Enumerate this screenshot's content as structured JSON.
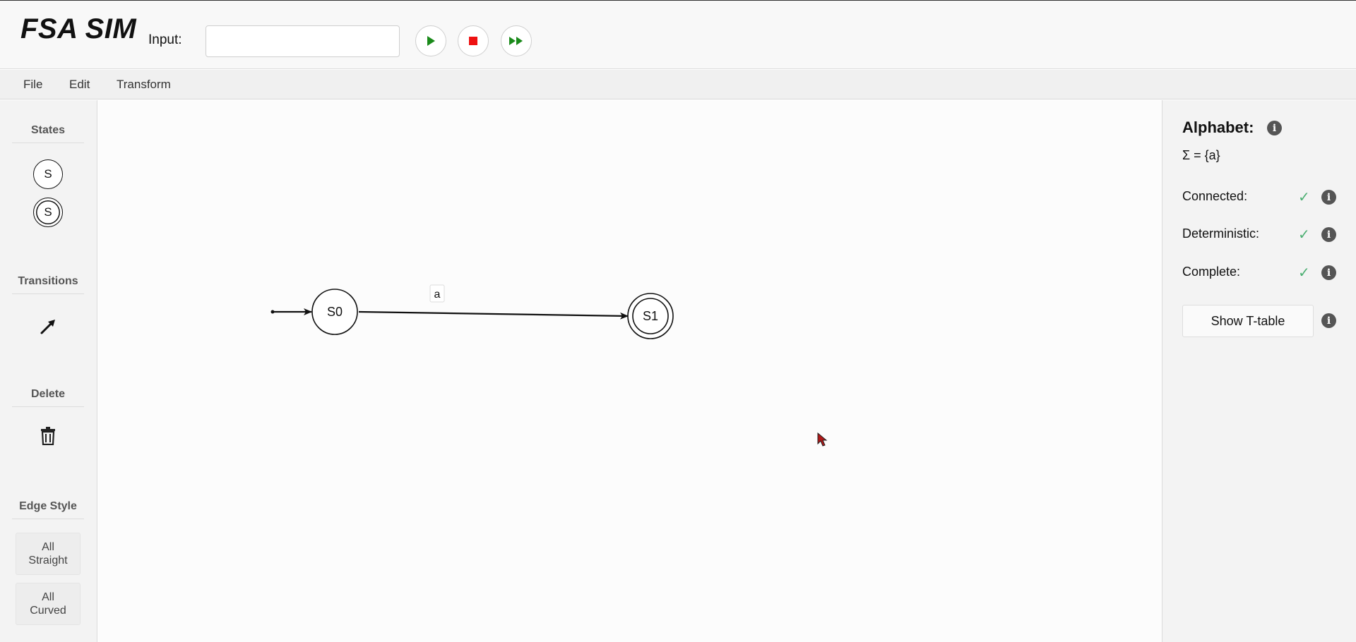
{
  "header": {
    "app_title": "FSA SIM",
    "input_label": "Input:",
    "input_value": "",
    "input_placeholder": ""
  },
  "controls": {
    "play_icon": "play-icon",
    "stop_icon": "stop-icon",
    "fast_forward_icon": "fast-forward-icon",
    "play_color": "#1a8a1a",
    "stop_color": "#ee1111"
  },
  "menu": {
    "items": [
      "File",
      "Edit",
      "Transform"
    ]
  },
  "toolbar": {
    "states_heading": "States",
    "state_tool_label": "S",
    "accept_state_tool_label": "S",
    "transitions_heading": "Transitions",
    "delete_heading": "Delete",
    "edge_style_heading": "Edge Style",
    "all_straight_label": "All Straight",
    "all_curved_label": "All Curved"
  },
  "automaton": {
    "states": [
      {
        "name": "S0",
        "initial": true,
        "accepting": false
      },
      {
        "name": "S1",
        "initial": false,
        "accepting": true
      }
    ],
    "transitions": [
      {
        "from": "S0",
        "to": "S1",
        "label": "a"
      }
    ]
  },
  "panel": {
    "alphabet_title": "Alphabet:",
    "alphabet_set": "Σ = {a}",
    "properties": [
      {
        "label": "Connected:",
        "value": "✓"
      },
      {
        "label": "Deterministic:",
        "value": "✓"
      },
      {
        "label": "Complete:",
        "value": "✓"
      }
    ],
    "show_ttable_label": "Show T-table",
    "check_color": "#4caf72"
  }
}
